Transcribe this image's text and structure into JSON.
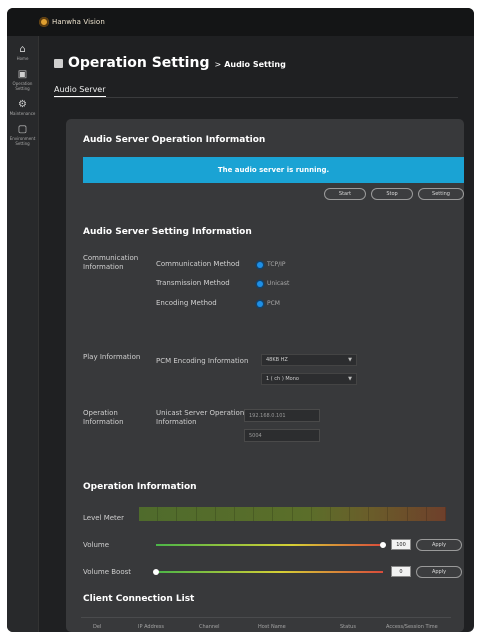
{
  "app": {
    "brand": "Hanwha Vision"
  },
  "sidebar": {
    "items": [
      {
        "icon": "home-icon",
        "label": "Home"
      },
      {
        "icon": "grid-icon",
        "label": "Operation Setting"
      },
      {
        "icon": "gear-icon",
        "label": "Maintenance"
      },
      {
        "icon": "monitor-icon",
        "label": "Environment Setting"
      }
    ]
  },
  "page": {
    "title": "Operation Setting",
    "crumb_sep": ">",
    "crumb": "Audio Setting",
    "tab": "Audio Server"
  },
  "server_info": {
    "title": "Audio Server Operation Information",
    "status": "The audio server is running.",
    "buttons": {
      "start": "Start",
      "stop": "Stop",
      "setting": "Setting"
    }
  },
  "setting_info": {
    "title": "Audio Server Setting Information",
    "communication_label": "Communication Information",
    "communication_method_label": "Communication Method",
    "communication_method_value": "TCP/IP",
    "transmission_method_label": "Transmission Method",
    "transmission_method_value": "Unicast",
    "encoding_method_label": "Encoding Method",
    "encoding_method_value": "PCM",
    "play_label": "Play Information",
    "pcm_label": "PCM Encoding Information",
    "pcm_select": "48KB HZ",
    "pcm_channel_select": "1 ( ch ) Mono",
    "operation_label": "Operation Information",
    "unicast_label": "Unicast Server Operation Information",
    "ip_value": "192.168.0.101",
    "port_value": "5004"
  },
  "operation": {
    "title": "Operation Information",
    "level_meter_label": "Level Meter",
    "volume_label": "Volume",
    "volume_value": "100",
    "volume_level": 1.0,
    "boost_label": "Volume Boost",
    "boost_value": "0",
    "boost_level": 0.0,
    "apply": "Apply"
  },
  "clients": {
    "title": "Client Connection List",
    "columns": [
      "Del",
      "IP Address",
      "Channel",
      "Host Name",
      "Status",
      "Access/Session Time"
    ]
  },
  "colors": {
    "accent": "#1aa3d4",
    "radio": "#1e8fe6"
  }
}
